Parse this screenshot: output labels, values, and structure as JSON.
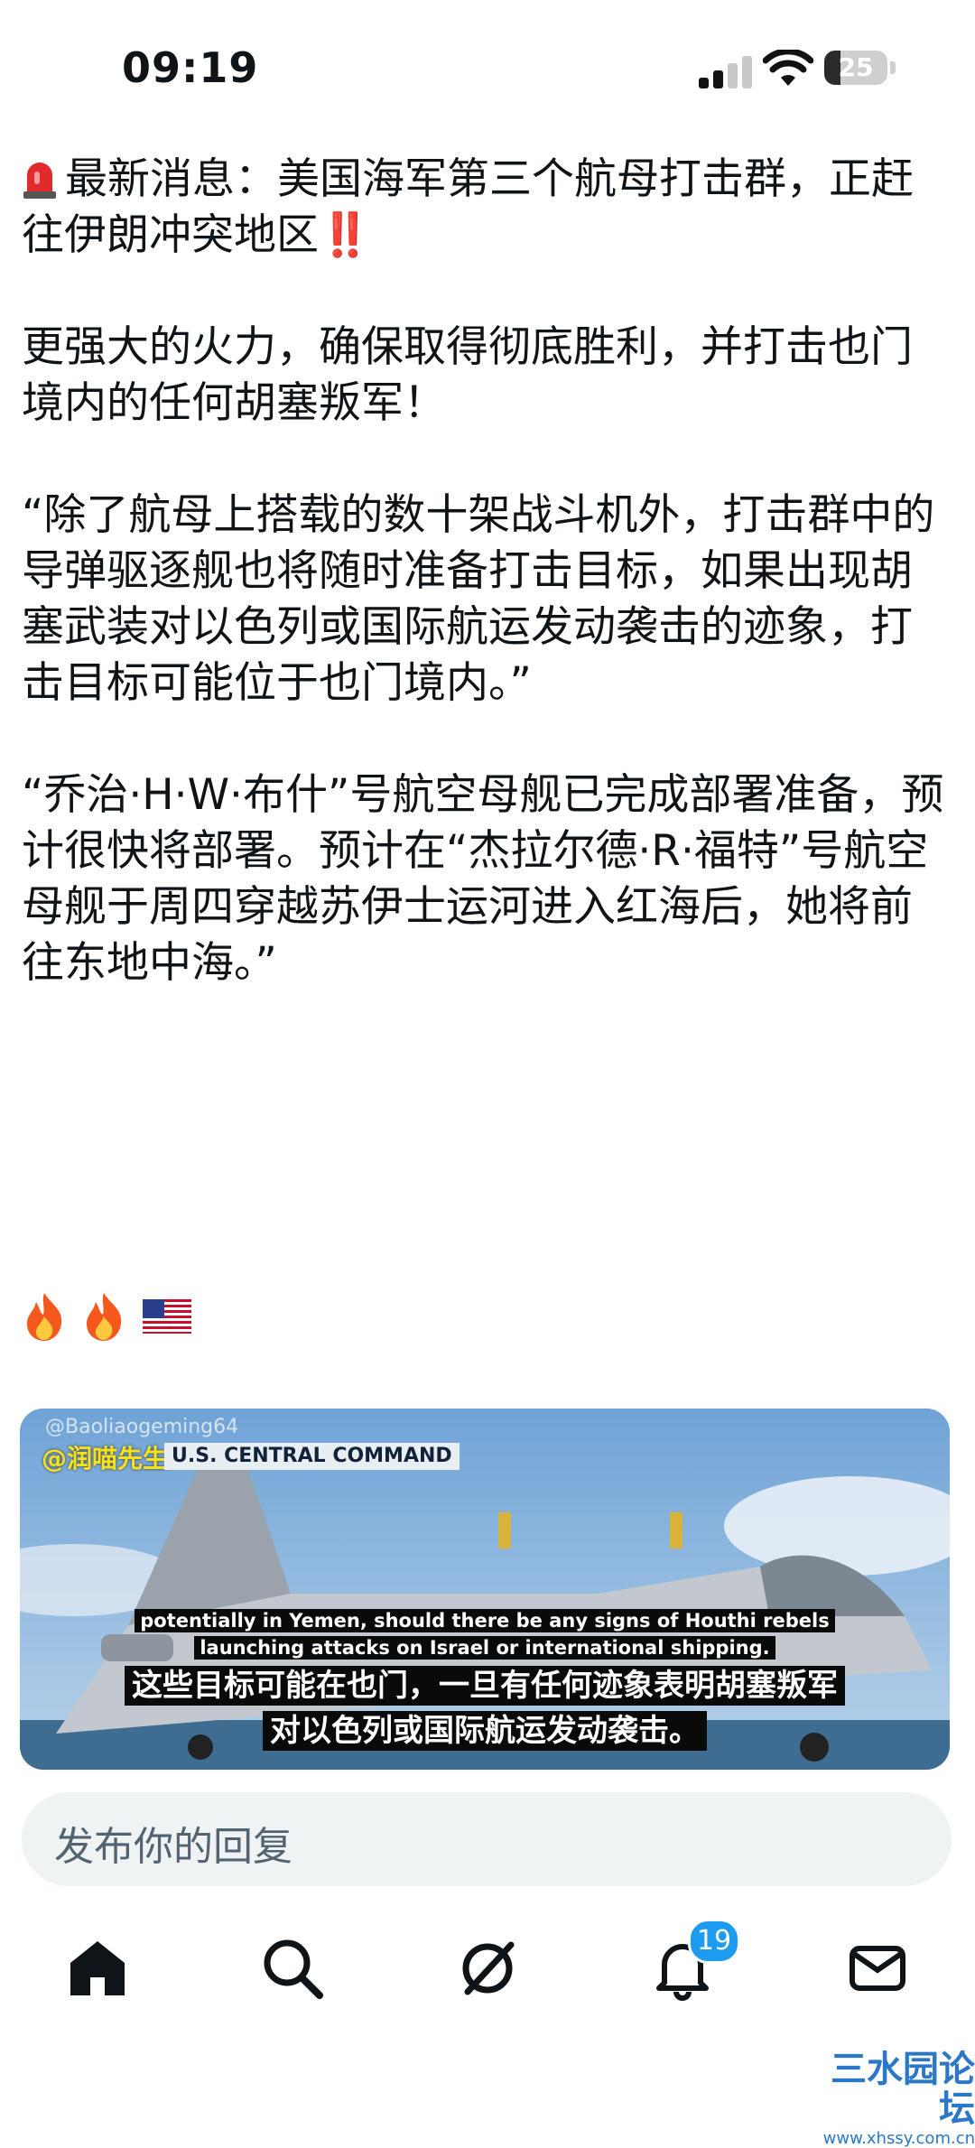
{
  "status_bar": {
    "time": "09:19",
    "battery": "25"
  },
  "post": {
    "line1": "最新消息：美国海军第三个航母打击群，正赶往伊朗冲突地区",
    "bangs": "‼️",
    "para2": "更强大的火力，确保取得彻底胜利，并打击也门境内的任何胡塞叛军！",
    "para3": "“除了航母上搭载的数十架战斗机外，打击群中的导弹驱逐舰也将随时准备打击目标，如果出现胡塞武装对以色列或国际航运发动袭击的迹象，打击目标可能位于也门境内。”",
    "para4": "“乔治·H·W·布什”号航空母舰已完成部署准备，预计很快将部署。预计在“杰拉尔德·R·福特”号航空母舰于周四穿越苏伊士运河进入红海后，她将前往东地中海。”"
  },
  "media": {
    "watermark_user": "@Baoliaogeming64",
    "watermark_cn": "@润喵先生",
    "channel": "U.S. CENTRAL COMMAND",
    "subtitle_en_1": "potentially in Yemen, should there be any signs of Houthi rebels",
    "subtitle_en_2": "launching attacks on Israel or international shipping.",
    "subtitle_zh_1": "这些目标可能在也门，一旦有任何迹象表明胡塞叛军",
    "subtitle_zh_2": "对以色列或国际航运发动袭击。"
  },
  "reply": {
    "placeholder": "发布你的回复"
  },
  "nav": {
    "notifications_badge": "19"
  },
  "footer": {
    "site_name": "三水园论坛",
    "site_url": "www.xhssy.com.cn"
  },
  "colors": {
    "accent": "#1d9bf0",
    "text": "#0f1419",
    "muted": "#536471",
    "reply_bg": "#eff3f4"
  }
}
